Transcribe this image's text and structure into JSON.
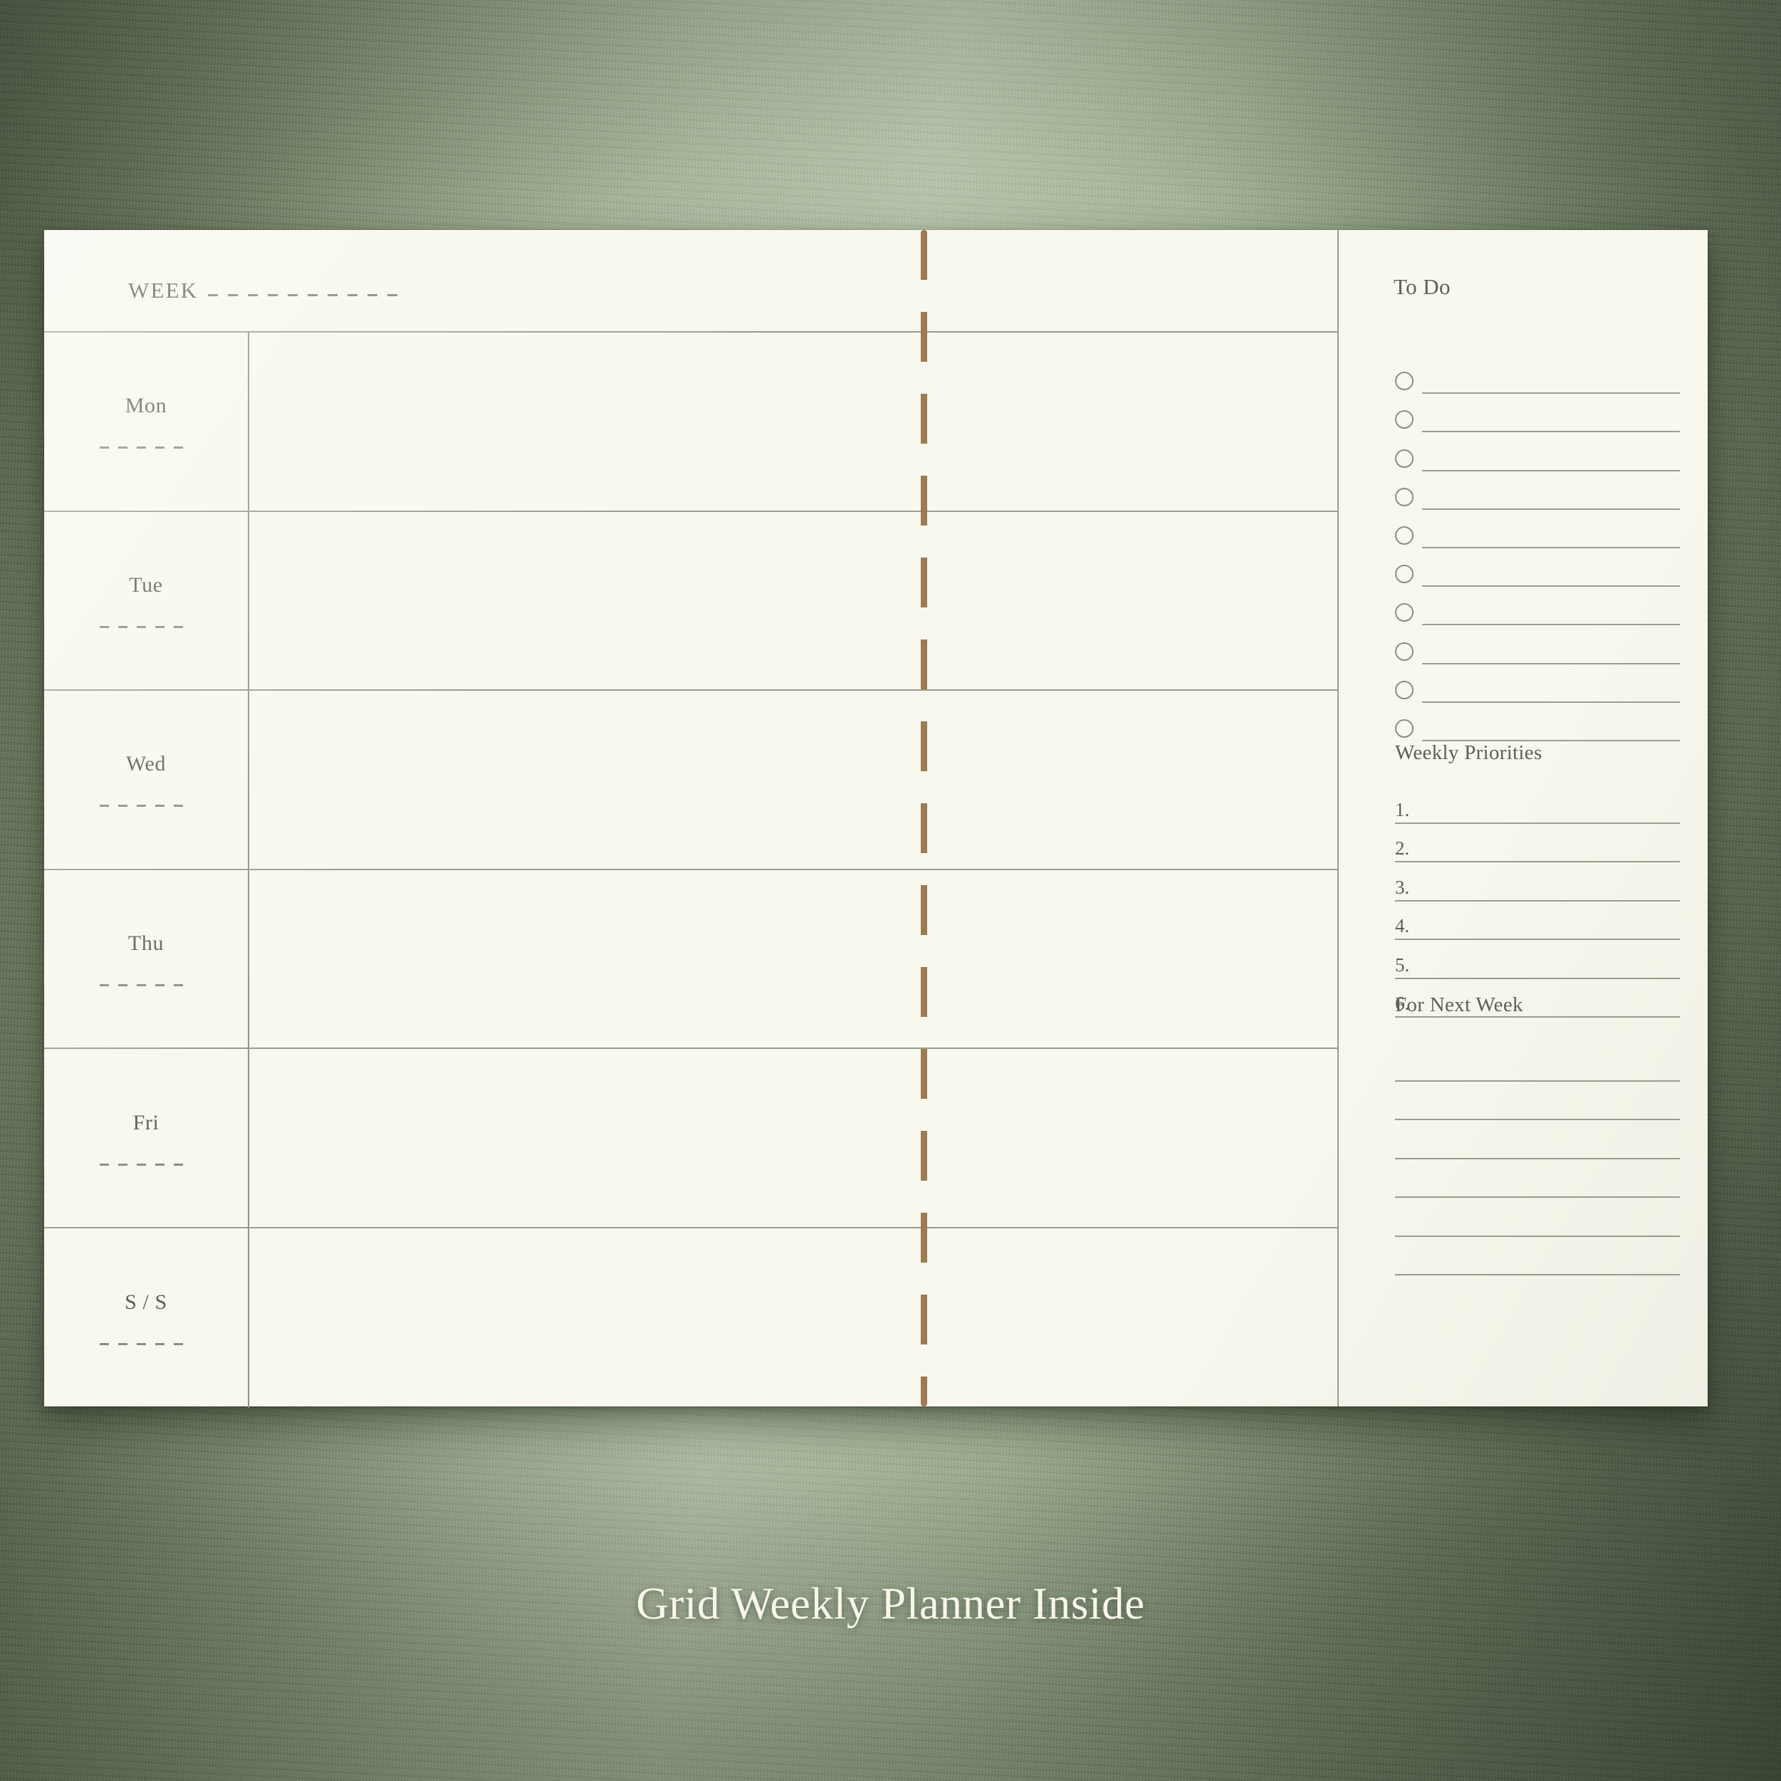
{
  "caption": "Grid Weekly Planner Inside",
  "planner": {
    "header": {
      "week_label": "WEEK",
      "todo_title": "To Do"
    },
    "days": [
      {
        "name": "Mon"
      },
      {
        "name": "Tue"
      },
      {
        "name": "Wed"
      },
      {
        "name": "Thu"
      },
      {
        "name": "Fri"
      },
      {
        "name": "S / S"
      }
    ],
    "todo": {
      "title": "To Do",
      "item_count": 10
    },
    "priorities": {
      "title": "Weekly Priorities",
      "numbers": [
        "1.",
        "2.",
        "3.",
        "4.",
        "5.",
        "6."
      ]
    },
    "next_week": {
      "title": "For Next Week",
      "line_count": 6
    }
  },
  "colors": {
    "paper": "#f8f8ee",
    "rule": "#9a9d8f",
    "ink": "#5d6155",
    "fold_dash": "#9d7b52",
    "wall": "#8a9a7c"
  }
}
